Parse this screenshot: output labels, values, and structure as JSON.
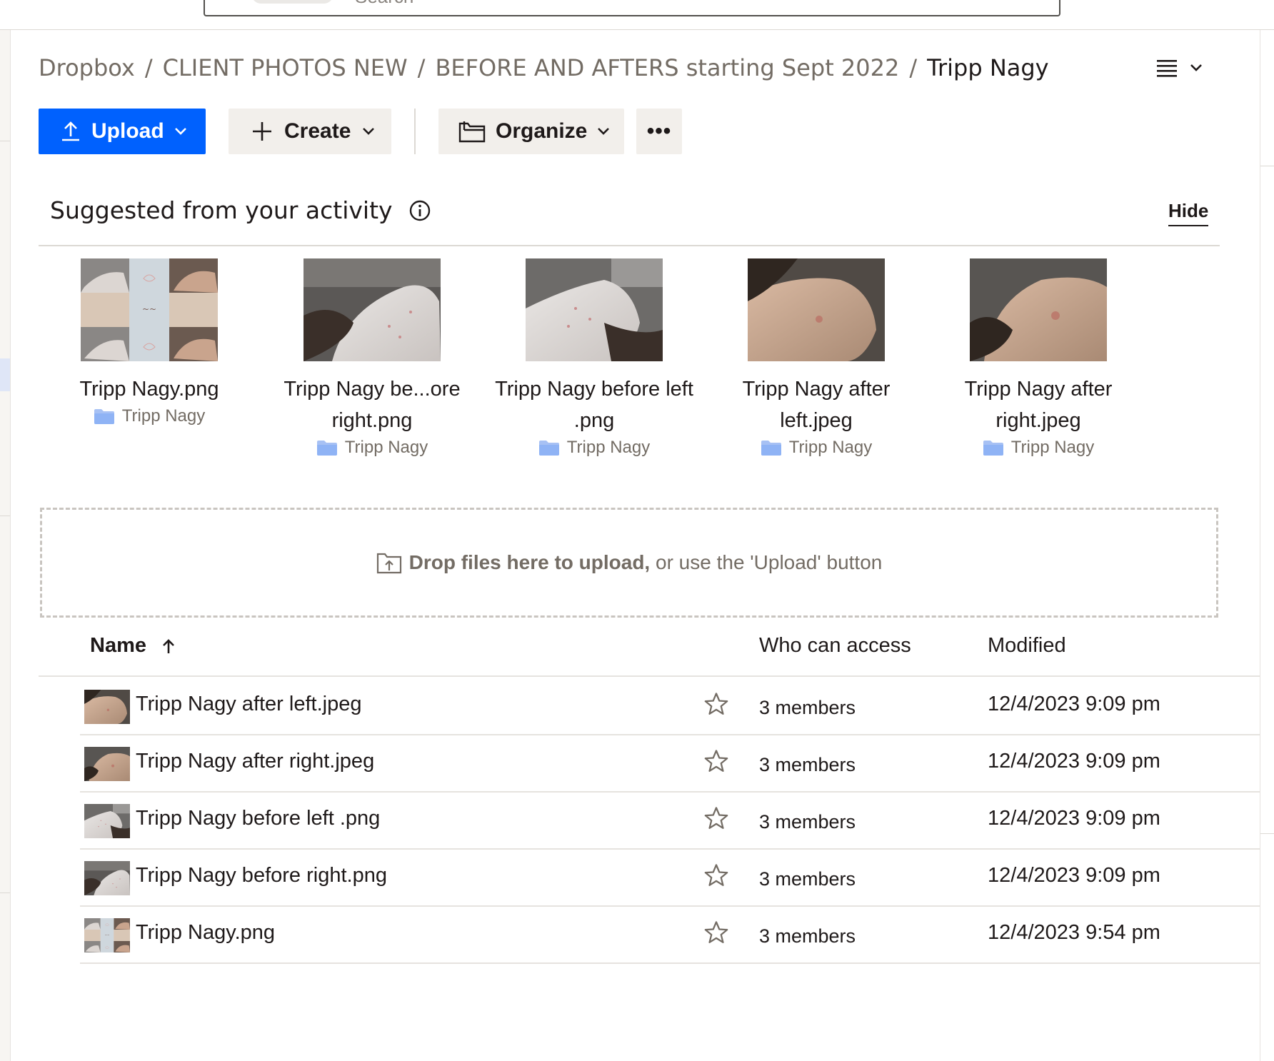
{
  "search": {
    "placeholder": "Search"
  },
  "breadcrumb": [
    {
      "label": "Dropbox"
    },
    {
      "label": "CLIENT PHOTOS NEW"
    },
    {
      "label": "BEFORE AND AFTERS starting Sept 2022"
    },
    {
      "label": "Tripp Nagy",
      "current": true
    }
  ],
  "toolbar": {
    "upload_label": "Upload",
    "create_label": "Create",
    "organize_label": "Organize",
    "more_label": "•••"
  },
  "suggested": {
    "title": "Suggested from your activity",
    "hide_label": "Hide",
    "items": [
      {
        "name_line1": "Tripp Nagy.png",
        "name_line2": "",
        "folder": "Tripp Nagy",
        "thumb": "collage"
      },
      {
        "name_line1": "Tripp Nagy be...ore",
        "name_line2": "right.png",
        "folder": "Tripp Nagy",
        "thumb": "before-right"
      },
      {
        "name_line1": "Tripp Nagy before left",
        "name_line2": ".png",
        "folder": "Tripp Nagy",
        "thumb": "before-left"
      },
      {
        "name_line1": "Tripp Nagy after",
        "name_line2": "left.jpeg",
        "folder": "Tripp Nagy",
        "thumb": "after-left"
      },
      {
        "name_line1": "Tripp Nagy after",
        "name_line2": "right.jpeg",
        "folder": "Tripp Nagy",
        "thumb": "after-right"
      }
    ]
  },
  "dropzone": {
    "bold_text": "Drop files here to upload,",
    "rest_text": " or use the 'Upload' button"
  },
  "table": {
    "columns": {
      "name": "Name",
      "access": "Who can access",
      "modified": "Modified"
    },
    "rows": [
      {
        "name": "Tripp Nagy after left.jpeg",
        "access": "3 members",
        "modified": "12/4/2023 9:09 pm",
        "thumb": "after-left"
      },
      {
        "name": "Tripp Nagy after right.jpeg",
        "access": "3 members",
        "modified": "12/4/2023 9:09 pm",
        "thumb": "after-right"
      },
      {
        "name": "Tripp Nagy before left .png",
        "access": "3 members",
        "modified": "12/4/2023 9:09 pm",
        "thumb": "before-left"
      },
      {
        "name": "Tripp Nagy before right.png",
        "access": "3 members",
        "modified": "12/4/2023 9:09 pm",
        "thumb": "before-right"
      },
      {
        "name": "Tripp Nagy.png",
        "access": "3 members",
        "modified": "12/4/2023 9:54 pm",
        "thumb": "collage"
      }
    ]
  },
  "colors": {
    "accent": "#0061fe",
    "button_bg": "#f2efeb",
    "folder": "#8fb3f5",
    "muted_text": "#736c64"
  }
}
